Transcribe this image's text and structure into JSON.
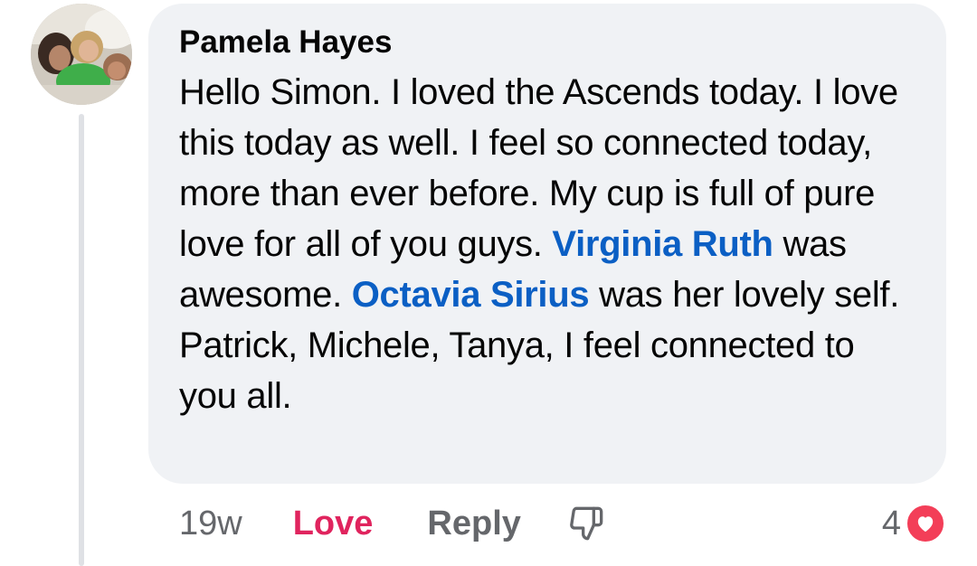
{
  "comment": {
    "author": "Pamela Hayes",
    "text_parts": [
      "Hello Simon. I loved the Ascends today. I love this today as well. I feel so connected today, more than ever before. My cup is full of pure love for all of you guys. ",
      "Virginia Ruth",
      " was awesome. ",
      "Octavia Sirius",
      " was her lovely self. Patrick, Michele, Tanya, I feel connected to you all."
    ],
    "mentions": [
      "Virginia Ruth",
      "Octavia Sirius"
    ]
  },
  "actions": {
    "timestamp": "19w",
    "love_label": "Love",
    "reply_label": "Reply",
    "dislike_icon": "thumbs-down-icon"
  },
  "reactions": {
    "count": "4",
    "type_icon": "heart-icon"
  },
  "colors": {
    "mention": "#0b5fc4",
    "love_active": "#e0245e",
    "love_badge": "#f33e58",
    "bubble": "#f0f2f5",
    "secondary_text": "#65676b"
  }
}
